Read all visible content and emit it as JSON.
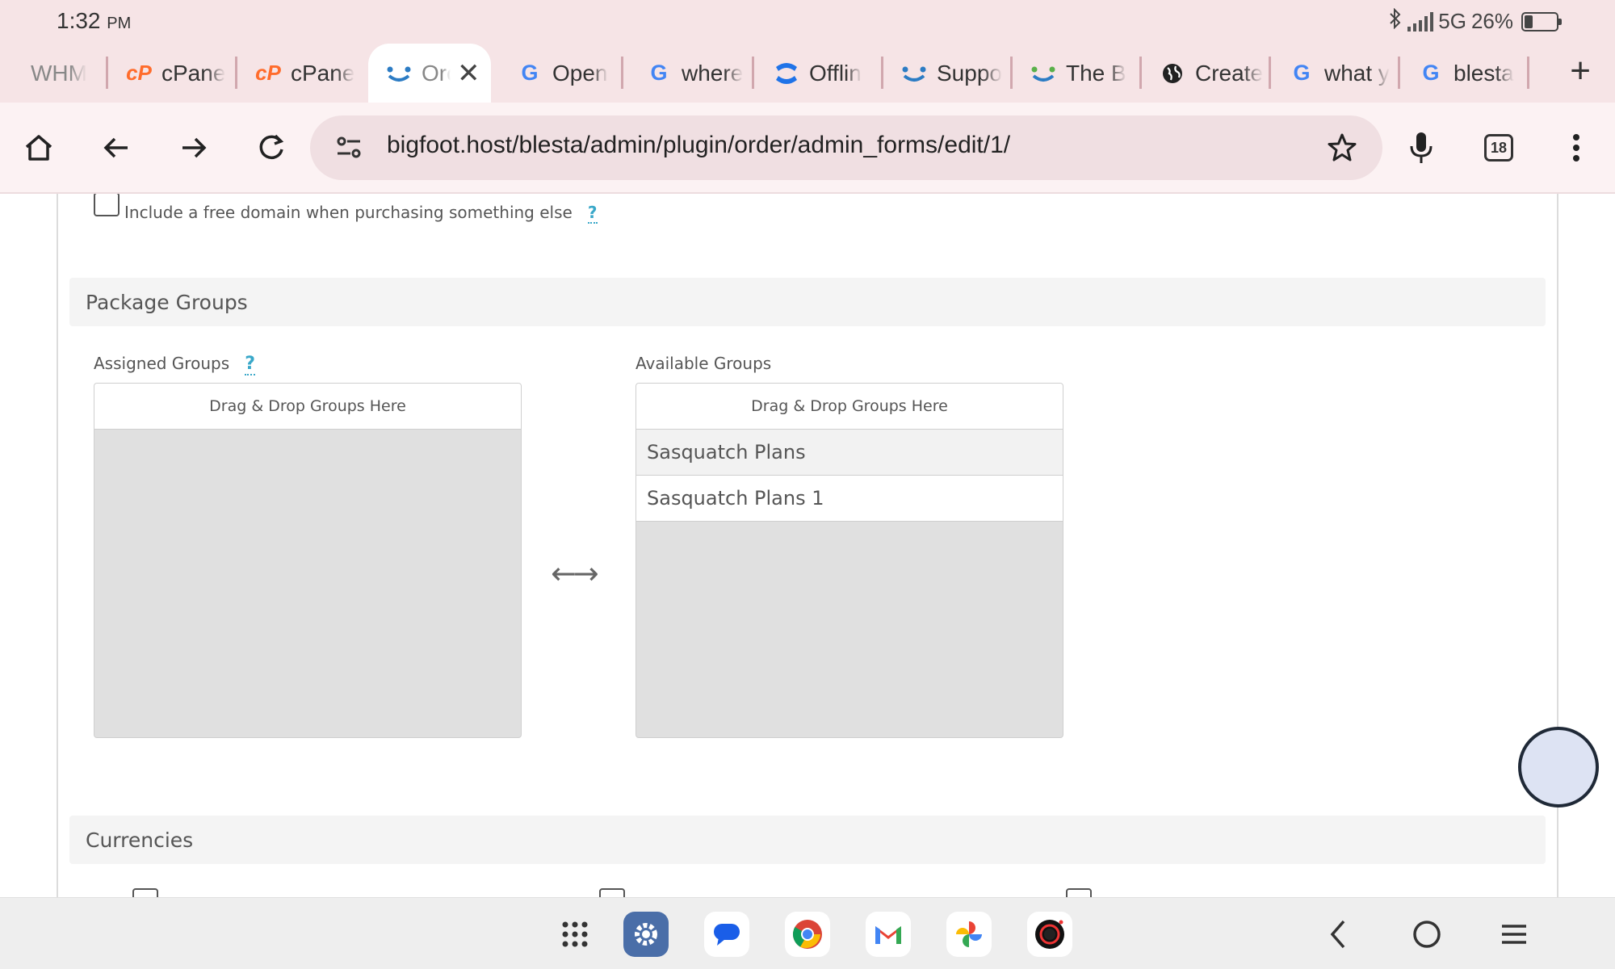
{
  "status_bar": {
    "time": "1:32",
    "ampm": "PM",
    "network": "5G",
    "battery": "26%",
    "battery_level": 0.26
  },
  "tabs": [
    {
      "label": "WHM",
      "icon": "none"
    },
    {
      "label": "cPane",
      "icon": "cpanel-icon"
    },
    {
      "label": "cPane",
      "icon": "cpanel-icon"
    },
    {
      "label": "Orc",
      "icon": "blesta-icon",
      "active": true
    },
    {
      "label": "Open",
      "icon": "google-icon"
    },
    {
      "label": "where",
      "icon": "google-icon"
    },
    {
      "label": "Offlin",
      "icon": "confluence-icon"
    },
    {
      "label": "Suppo",
      "icon": "blesta-icon"
    },
    {
      "label": "The B",
      "icon": "blesta-green-icon"
    },
    {
      "label": "Create",
      "icon": "globe-icon"
    },
    {
      "label": "what y",
      "icon": "google-icon"
    },
    {
      "label": "blesta",
      "icon": "google-icon"
    }
  ],
  "toolbar": {
    "url": "bigfoot.host/blesta/admin/plugin/order/admin_forms/edit/1/",
    "tab_count": "18"
  },
  "page": {
    "free_domain_label": "Include a free domain when purchasing something else",
    "help_mark": "?",
    "package_groups_title": "Package Groups",
    "assigned_groups_label": "Assigned Groups",
    "available_groups_label": "Available Groups",
    "drop_hint": "Drag & Drop Groups Here",
    "available_groups": [
      "Sasquatch Plans",
      "Sasquatch Plans 1"
    ],
    "currencies_title": "Currencies"
  },
  "dock_apps": [
    "app-drawer-icon",
    "settings-icon",
    "messages-icon",
    "chrome-icon",
    "gmail-icon",
    "photos-icon",
    "camera-icon"
  ],
  "colors": {
    "chrome_bg": "#f6e4e6",
    "help_accent": "#3aa8c9",
    "cpanel_orange": "#ff6c2c"
  }
}
